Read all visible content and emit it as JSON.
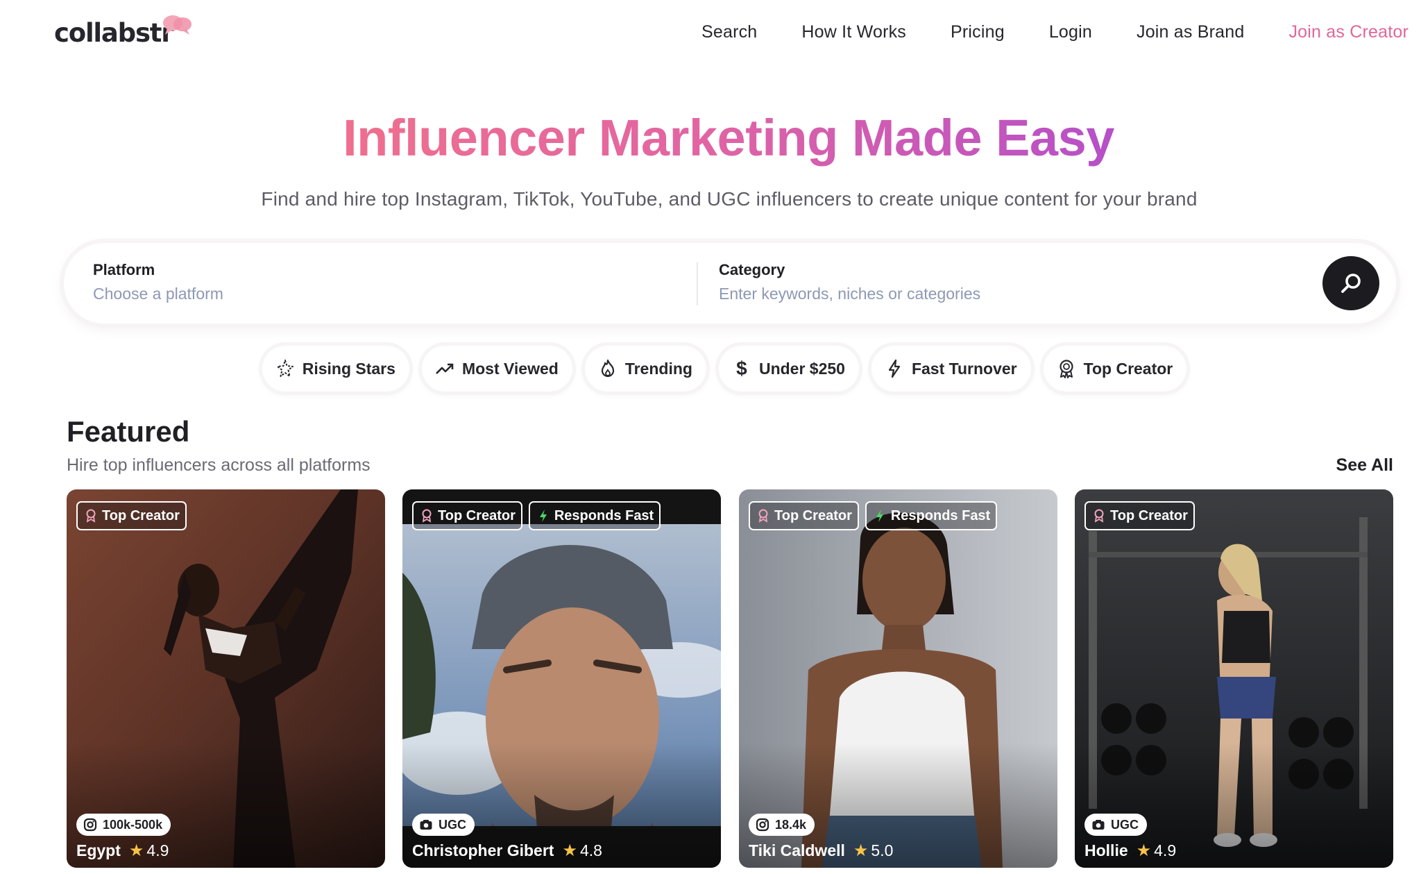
{
  "brand": {
    "name": "collabstr"
  },
  "nav": {
    "items": [
      {
        "label": "Search"
      },
      {
        "label": "How It Works"
      },
      {
        "label": "Pricing"
      },
      {
        "label": "Login"
      },
      {
        "label": "Join as Brand"
      },
      {
        "label": "Join as Creator"
      }
    ]
  },
  "hero": {
    "title": "Influencer Marketing Made Easy",
    "subtitle": "Find and hire top Instagram, TikTok, YouTube, and UGC influencers to create unique content for your brand"
  },
  "search": {
    "platform_label": "Platform",
    "platform_placeholder": "Choose a platform",
    "category_label": "Category",
    "category_placeholder": "Enter keywords, niches or categories",
    "button_icon": "search-icon"
  },
  "chips": [
    {
      "label": "Rising Stars",
      "icon": "sparkle-icon"
    },
    {
      "label": "Most Viewed",
      "icon": "trending-up-icon"
    },
    {
      "label": "Trending",
      "icon": "flame-icon"
    },
    {
      "label": "Under $250",
      "icon": "dollar-icon"
    },
    {
      "label": "Fast Turnover",
      "icon": "lightning-icon"
    },
    {
      "label": "Top Creator",
      "icon": "award-icon"
    }
  ],
  "featured": {
    "title": "Featured",
    "subtitle": "Hire top influencers across all platforms",
    "see_all": "See All",
    "cards": [
      {
        "badges": [
          "Top Creator"
        ],
        "stat_icon": "instagram-icon",
        "stat": "100k-500k",
        "name": "Egypt",
        "rating": "4.9"
      },
      {
        "badges": [
          "Top Creator",
          "Responds Fast"
        ],
        "stat_icon": "camera-icon",
        "stat": "UGC",
        "name": "Christopher Gibert",
        "rating": "4.8"
      },
      {
        "badges": [
          "Top Creator",
          "Responds Fast"
        ],
        "stat_icon": "instagram-icon",
        "stat": "18.4k",
        "name": "Tiki Caldwell",
        "rating": "5.0"
      },
      {
        "badges": [
          "Top Creator"
        ],
        "stat_icon": "camera-icon",
        "stat": "UGC",
        "name": "Hollie",
        "rating": "4.9"
      }
    ]
  },
  "colors": {
    "accent_pink": "#e0669a",
    "gradient_start": "#ef6f8e",
    "gradient_end": "#b64fc8",
    "dark": "#1c1c20",
    "star": "#f6c347"
  }
}
